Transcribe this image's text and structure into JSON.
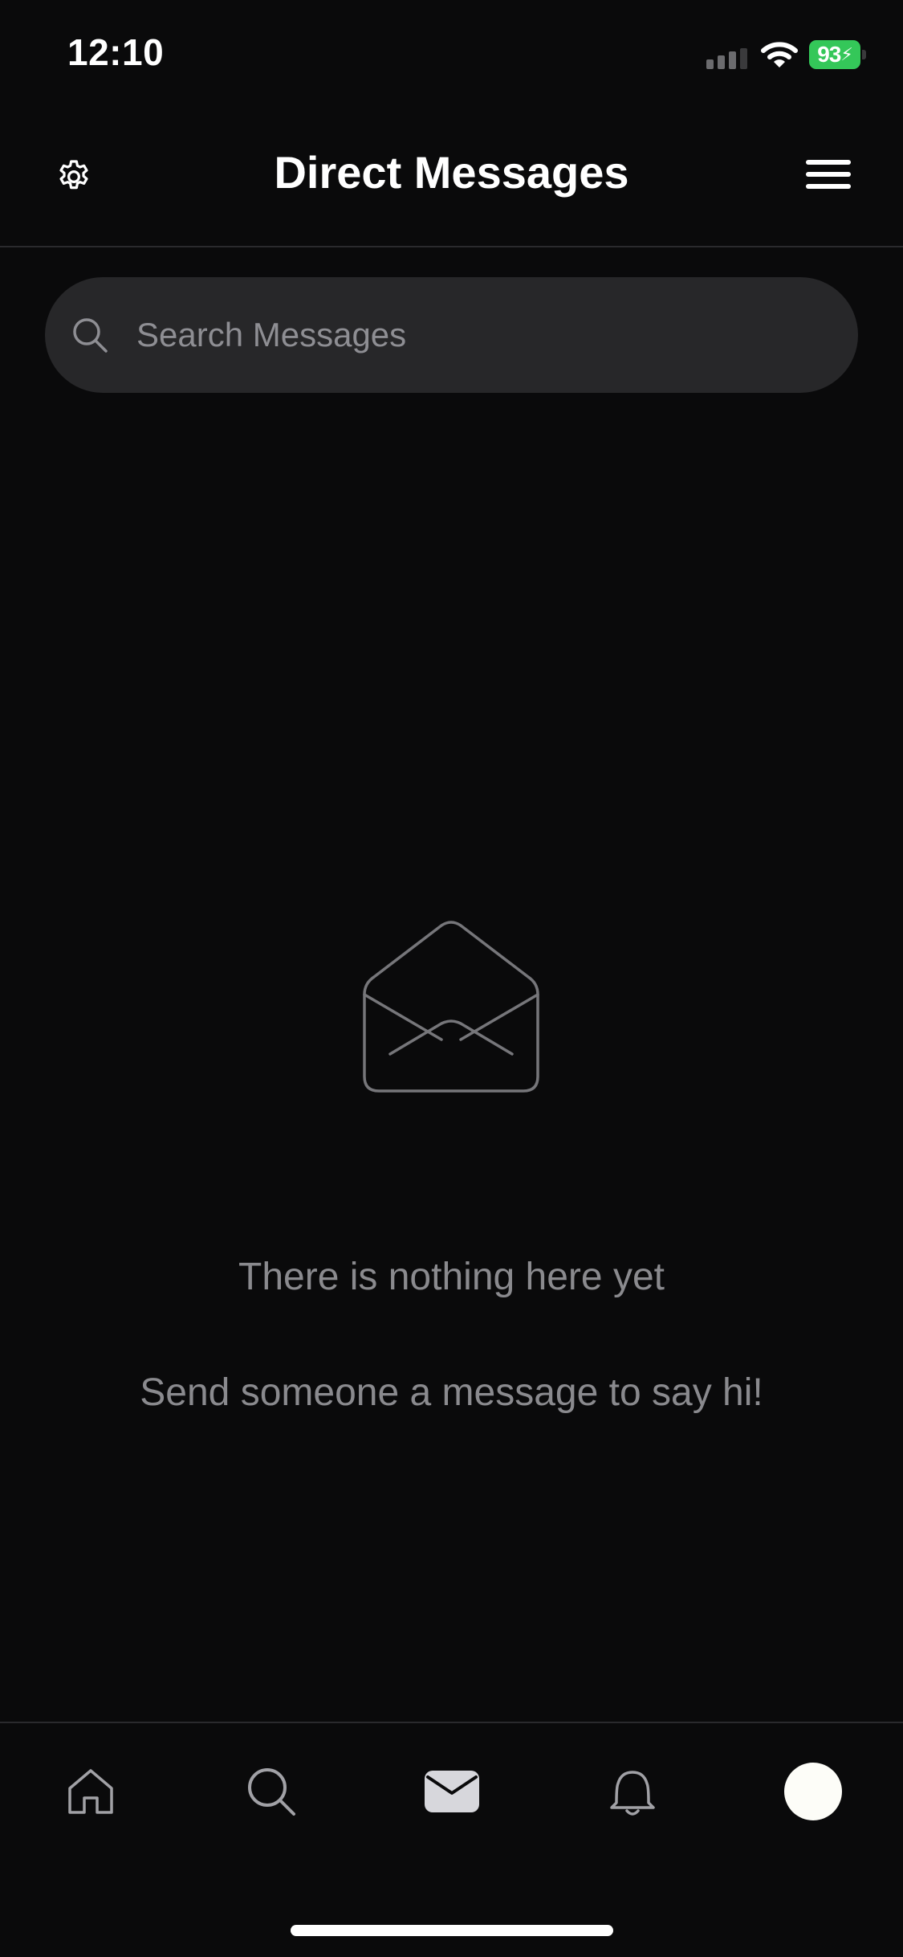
{
  "status_bar": {
    "time": "12:10",
    "battery_level": "93"
  },
  "header": {
    "title": "Direct Messages",
    "settings_icon": "gear-icon",
    "menu_icon": "hamburger-menu-icon"
  },
  "search": {
    "placeholder": "Search Messages",
    "value": ""
  },
  "empty_state": {
    "icon": "envelope-open-icon",
    "title": "There is nothing here yet",
    "subtitle": "Send someone a message to say hi!"
  },
  "tab_bar": {
    "active_tab": "messages",
    "tabs": [
      {
        "id": "home",
        "icon": "home-icon"
      },
      {
        "id": "search",
        "icon": "search-icon"
      },
      {
        "id": "messages",
        "icon": "envelope-icon"
      },
      {
        "id": "notifications",
        "icon": "bell-icon"
      },
      {
        "id": "profile",
        "icon": "avatar"
      }
    ]
  },
  "colors": {
    "background": "#0a0a0b",
    "search_background": "#272729",
    "muted_text": "#8a8a8e",
    "battery_green": "#34c759"
  }
}
